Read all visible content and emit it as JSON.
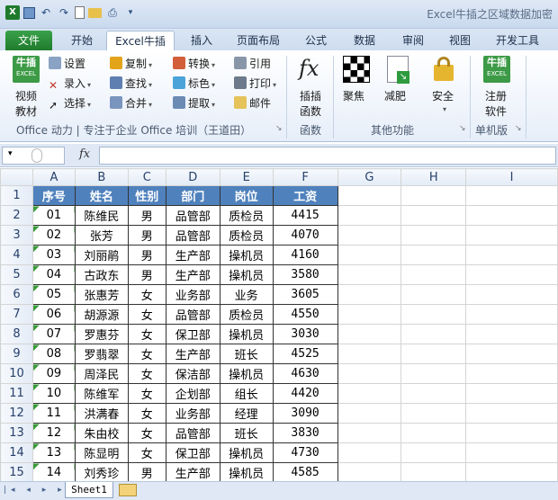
{
  "window": {
    "title": "Excel牛插之区域数据加密"
  },
  "tabs": [
    "文件",
    "开始",
    "Excel牛插",
    "插入",
    "页面布局",
    "公式",
    "数据",
    "审阅",
    "视图",
    "开发工具"
  ],
  "ribbon": {
    "niucha_label": "牛插",
    "niucha_sub": "EXCEL",
    "video_l1": "视频",
    "video_l2": "教材",
    "settings": "设置",
    "record": "录入",
    "select": "选择",
    "copy": "复制",
    "find": "查找",
    "merge": "合并",
    "convert": "转换",
    "color": "标色",
    "extract": "提取",
    "quote": "引用",
    "print": "打印",
    "mail": "邮件",
    "group1_label": "Office 动力 | 专注于企业 Office 培训（王道田）",
    "insert_fn_l1": "插插",
    "insert_fn_l2": "函数",
    "group_fn_label": "函数",
    "focus": "聚焦",
    "slim": "减肥",
    "security": "安全",
    "group_other_label": "其他功能",
    "register_l1": "注册",
    "register_l2": "软件",
    "group_single_label": "单机版"
  },
  "formula_bar": {
    "fx": "fx",
    "value": ""
  },
  "columns": [
    "A",
    "B",
    "C",
    "D",
    "E",
    "F",
    "G",
    "H",
    "I"
  ],
  "rows": [
    "1",
    "2",
    "3",
    "4",
    "5",
    "6",
    "7",
    "8",
    "9",
    "10",
    "11",
    "12",
    "13",
    "14",
    "15"
  ],
  "table": {
    "headers": [
      "序号",
      "姓名",
      "性别",
      "部门",
      "岗位",
      "工资"
    ],
    "data": [
      [
        "01",
        "陈维民",
        "男",
        "品管部",
        "质检员",
        "4415"
      ],
      [
        "02",
        "张芳",
        "男",
        "品管部",
        "质检员",
        "4070"
      ],
      [
        "03",
        "刘丽鹃",
        "男",
        "生产部",
        "操机员",
        "4160"
      ],
      [
        "04",
        "古政东",
        "男",
        "生产部",
        "操机员",
        "3580"
      ],
      [
        "05",
        "张惠芳",
        "女",
        "业务部",
        "业务",
        "3605"
      ],
      [
        "06",
        "胡源源",
        "女",
        "品管部",
        "质检员",
        "4550"
      ],
      [
        "07",
        "罗惠芬",
        "女",
        "保卫部",
        "操机员",
        "3030"
      ],
      [
        "08",
        "罗翡翠",
        "女",
        "生产部",
        "班长",
        "4525"
      ],
      [
        "09",
        "周泽民",
        "女",
        "保洁部",
        "操机员",
        "4630"
      ],
      [
        "10",
        "陈维军",
        "女",
        "企划部",
        "组长",
        "4420"
      ],
      [
        "11",
        "洪满春",
        "女",
        "业务部",
        "经理",
        "3090"
      ],
      [
        "12",
        "朱由校",
        "女",
        "品管部",
        "班长",
        "3830"
      ],
      [
        "13",
        "陈显明",
        "女",
        "保卫部",
        "操机员",
        "4730"
      ],
      [
        "14",
        "刘秀珍",
        "男",
        "生产部",
        "操机员",
        "4585"
      ]
    ]
  },
  "sheets": [
    "Sheet1"
  ],
  "colors": {
    "header_fill": "#4f81bd",
    "file_tab": "#1f7b2c",
    "accent": "#2b579a"
  }
}
